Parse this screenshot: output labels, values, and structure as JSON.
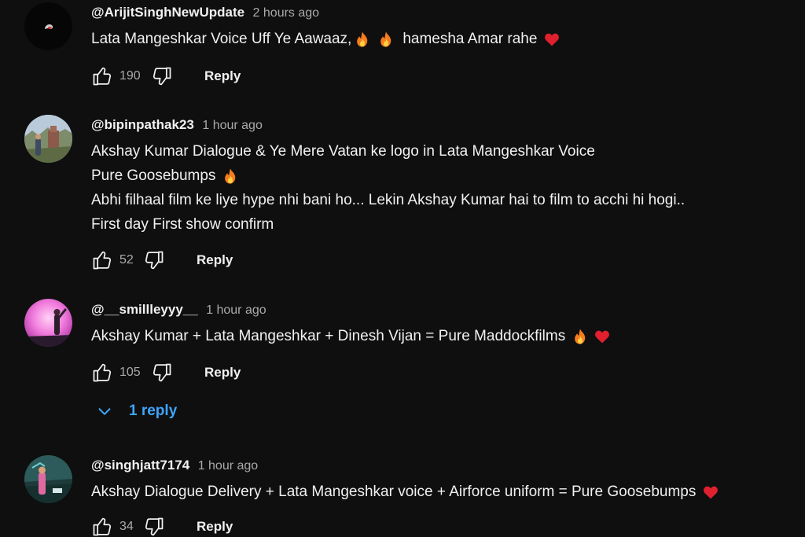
{
  "comments": [
    {
      "author": "@ArijitSinghNewUpdate",
      "time": "2 hours ago",
      "lines": [
        "Lata Mangeshkar Voice Uff Ye Aawaaz,",
        "hamesha Amar rahe"
      ],
      "likes": "190",
      "reply_label": "Reply"
    },
    {
      "author": "@bipinpathak23",
      "time": "1 hour ago",
      "lines": [
        "Akshay Kumar Dialogue & Ye Mere Vatan ke logo in Lata Mangeshkar Voice",
        "Pure Goosebumps",
        "Abhi filhaal film ke liye hype nhi bani ho... Lekin Akshay Kumar hai to film to acchi hi hogi..",
        "First day First show confirm"
      ],
      "likes": "52",
      "reply_label": "Reply"
    },
    {
      "author": "@__smillleyyy__",
      "time": "1 hour ago",
      "lines": [
        "Akshay Kumar + Lata Mangeshkar + Dinesh Vijan = Pure Maddockfilms"
      ],
      "likes": "105",
      "reply_label": "Reply",
      "replies_label": "1 reply"
    },
    {
      "author": "@singhjatt7174",
      "time": "1 hour ago",
      "lines": [
        "Akshay Dialogue Delivery + Lata Mangeshkar voice + Airforce uniform = Pure Goosebumps"
      ],
      "likes": "34",
      "reply_label": "Reply"
    }
  ],
  "icons": {
    "like": "thumbs-up-icon",
    "dislike": "thumbs-down-icon",
    "fire": "fire-emoji-icon",
    "heart": "red-heart-emoji-icon",
    "expand": "chevron-down-icon"
  },
  "colors": {
    "background": "#0f0f0f",
    "text": "#f1f1f1",
    "secondary_text": "#aaaaaa",
    "link_blue": "#3ea6ff",
    "heart_red": "#e0202f"
  }
}
